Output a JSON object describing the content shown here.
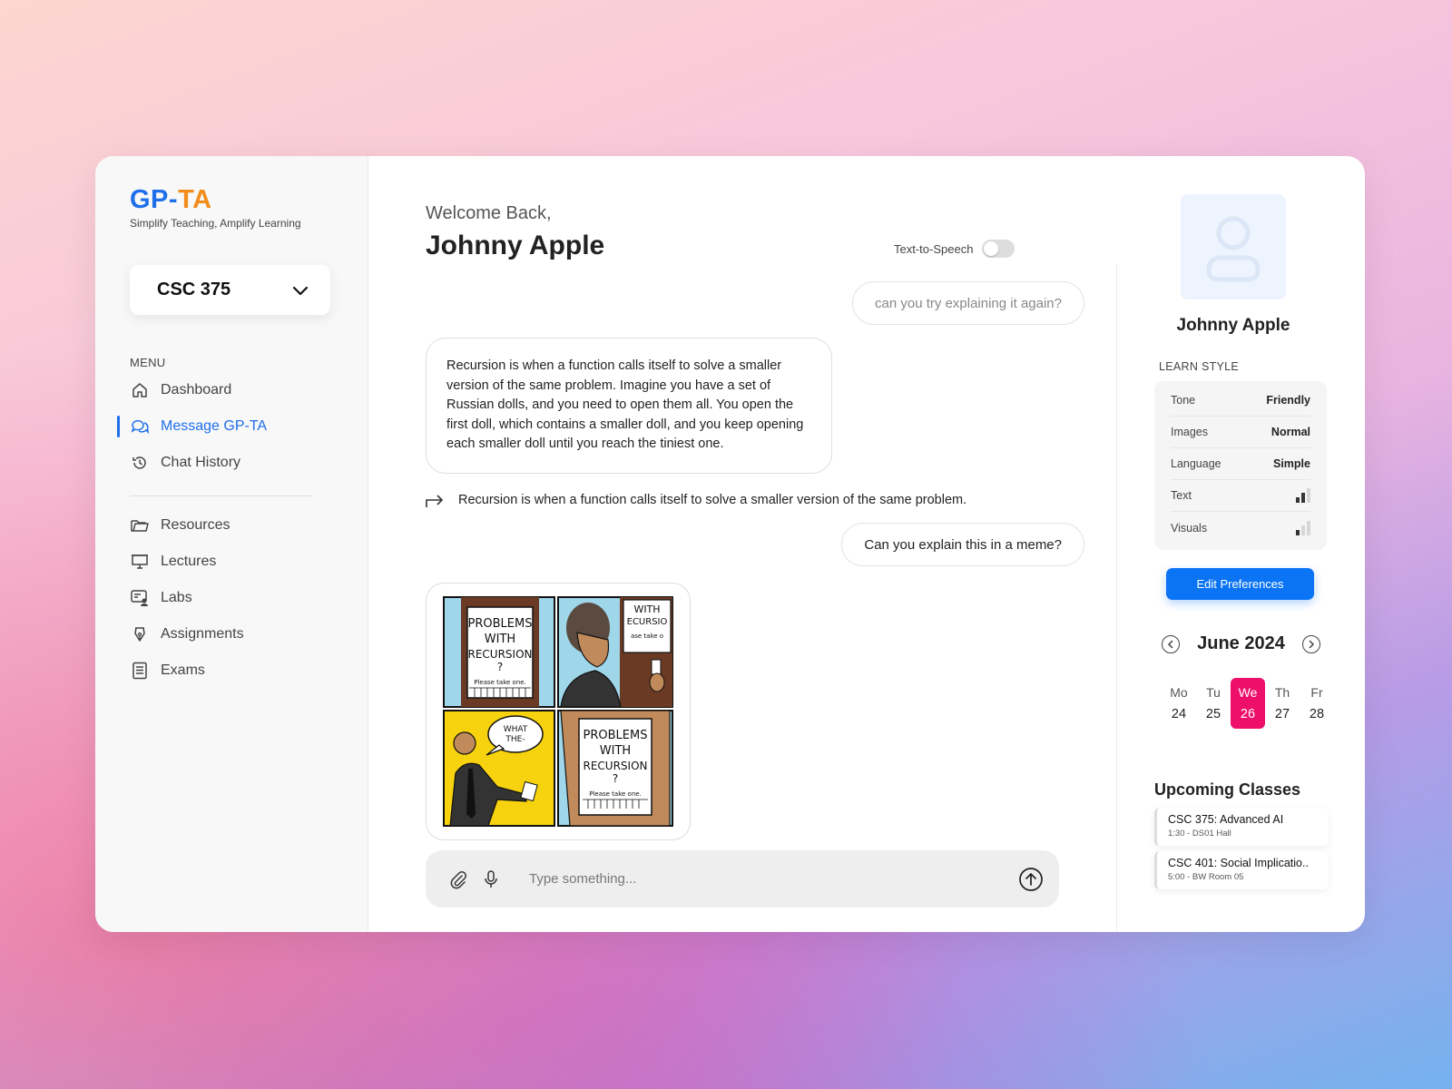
{
  "brand": {
    "name_gp": "GP",
    "name_dash": "-",
    "name_ta": "TA",
    "tagline": "Simplify Teaching, Amplify Learning"
  },
  "course": {
    "selected": "CSC 375"
  },
  "menu": {
    "title": "MENU",
    "primary": [
      {
        "label": "Dashboard",
        "icon": "home-icon"
      },
      {
        "label": "Message GP-TA",
        "icon": "chat-icon",
        "active": true
      },
      {
        "label": "Chat History",
        "icon": "history-icon"
      }
    ],
    "secondary": [
      {
        "label": "Resources",
        "icon": "folder-icon"
      },
      {
        "label": "Lectures",
        "icon": "presentation-icon"
      },
      {
        "label": "Labs",
        "icon": "lab-icon"
      },
      {
        "label": "Assignments",
        "icon": "pen-nib-icon"
      },
      {
        "label": "Exams",
        "icon": "document-icon"
      }
    ]
  },
  "header": {
    "welcome": "Welcome Back,",
    "user_name": "Johnny Apple",
    "tts_label": "Text-to-Speech",
    "tts_on": false
  },
  "chat": {
    "user_msg_1": "can you try explaining it again?",
    "bot_msg_1": "Recursion is when a function calls itself to solve a smaller version of the same problem. Imagine you have a set of Russian dolls, and you need to open them all. You open the first doll, which contains a smaller doll, and you keep opening each smaller doll until you reach the tiniest one.",
    "summary": "Recursion is when a function calls itself to solve a smaller version of the same problem.",
    "user_msg_2": "Can you explain this in a meme?",
    "meme": {
      "panel1_lines": [
        "PROBLEMS",
        "WITH",
        "RECURSION",
        "?"
      ],
      "panel1_footer": "Please take one.",
      "panel2_lines": [
        "WITH",
        "ECURSIO"
      ],
      "panel2_footer": "ase take o",
      "panel3_speech": [
        "WHAT",
        "THE-"
      ],
      "panel4_lines": [
        "PROBLEMS",
        "WITH",
        "RECURSION",
        "?"
      ],
      "panel4_footer": "Please take one."
    }
  },
  "composer": {
    "placeholder": "Type something..."
  },
  "profile": {
    "name": "Johnny Apple",
    "learn_style_title": "LEARN STYLE",
    "learn_style": [
      {
        "label": "Tone",
        "value": "Friendly"
      },
      {
        "label": "Images",
        "value": "Normal"
      },
      {
        "label": "Language",
        "value": "Simple"
      },
      {
        "label": "Text",
        "level": 2,
        "max": 3
      },
      {
        "label": "Visuals",
        "level": 1,
        "max": 3
      }
    ],
    "edit_label": "Edit Preferences"
  },
  "calendar": {
    "title": "June 2024",
    "days": [
      {
        "dow": "Mo",
        "num": "24"
      },
      {
        "dow": "Tu",
        "num": "25"
      },
      {
        "dow": "We",
        "num": "26",
        "selected": true
      },
      {
        "dow": "Th",
        "num": "27"
      },
      {
        "dow": "Fr",
        "num": "28"
      }
    ],
    "accent": "#ee0f6b"
  },
  "upcoming": {
    "title": "Upcoming Classes",
    "classes": [
      {
        "name": "CSC 375: Advanced AI",
        "time": "1:30 - DS01 Hall"
      },
      {
        "name": "CSC 401: Social Implicatio..",
        "time": "5:00 - BW Room 05"
      }
    ]
  },
  "colors": {
    "primary": "#1f6feb",
    "brand_orange": "#f28c1b",
    "button": "#0a74f5"
  }
}
